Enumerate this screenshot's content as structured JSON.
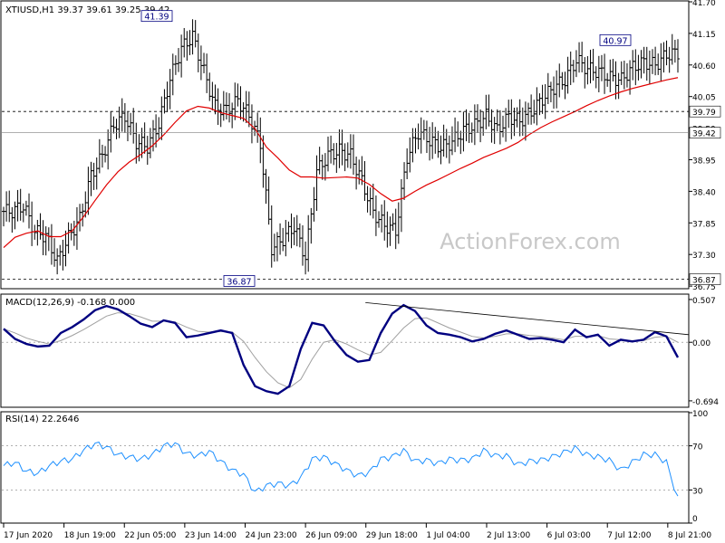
{
  "colors": {
    "background": "#ffffff",
    "frame": "#000000",
    "bar": "#000000",
    "ma": "#e00000",
    "macd_line": "#000080",
    "macd_signal": "#a0a0a0",
    "rsi_line": "#1e90ff",
    "level_line": "#808080",
    "watermark": "#c8c8c8",
    "label_border": "#000080"
  },
  "watermark": "ActionForex.com",
  "chart_data": [
    {
      "type": "ohlc",
      "panel": "price",
      "header": "XTIUSD,H1  39.37 39.61 39.25 39.42",
      "ylim": [
        36.72,
        41.7
      ],
      "yticks": [
        "41.70",
        "41.15",
        "40.60",
        "40.05",
        "39.50",
        "38.95",
        "38.40",
        "37.85",
        "37.30",
        "36.75"
      ],
      "ytick_values": [
        41.7,
        41.15,
        40.6,
        40.05,
        39.5,
        38.95,
        38.4,
        37.85,
        37.3,
        36.75
      ],
      "x": [
        "17 Jun 2020",
        "18 Jun 19:00",
        "22 Jun 05:00",
        "23 Jun 14:00",
        "24 Jun 23:00",
        "26 Jun 09:00",
        "29 Jun 18:00",
        "1 Jul 04:00",
        "2 Jul 13:00",
        "6 Jul 03:00",
        "7 Jul 12:00",
        "8 Jul 21:00"
      ],
      "last_price": 39.42,
      "last_price_label": "39.42",
      "levels": [
        {
          "value": 39.79,
          "label": "39.79",
          "style": "dashed"
        },
        {
          "value": 36.87,
          "label": "36.87",
          "style": "dashed"
        }
      ],
      "annotations": [
        {
          "text": "41.39",
          "value": 41.39
        },
        {
          "text": "36.87",
          "value": 36.87
        },
        {
          "text": "40.97",
          "value": 40.97
        }
      ],
      "series": [
        {
          "kind": "close",
          "values": [
            38.05,
            38.15,
            37.7,
            37.62,
            37.18,
            37.6,
            37.92,
            38.68,
            39.02,
            39.55,
            39.71,
            39.26,
            39.18,
            39.58,
            40.36,
            40.89,
            41.1,
            40.48,
            39.87,
            39.81,
            39.98,
            39.72,
            39.23,
            37.41,
            37.57,
            37.79,
            37.25,
            38.75,
            39.02,
            39.11,
            39.02,
            38.58,
            38.03,
            37.81,
            37.71,
            39.0,
            39.43,
            39.29,
            39.16,
            39.26,
            39.46,
            39.55,
            39.71,
            39.46,
            39.7,
            39.62,
            39.78,
            40.01,
            40.21,
            40.34,
            40.69,
            40.53,
            40.48,
            40.38,
            40.34,
            40.56,
            40.65,
            40.6,
            40.78,
            40.81
          ]
        },
        {
          "kind": "moving_average",
          "values": [
            37.42,
            37.6,
            37.67,
            37.71,
            37.61,
            37.61,
            37.71,
            37.96,
            38.24,
            38.51,
            38.74,
            38.91,
            39.04,
            39.19,
            39.38,
            39.6,
            39.8,
            39.88,
            39.85,
            39.77,
            39.72,
            39.67,
            39.49,
            39.17,
            38.98,
            38.77,
            38.65,
            38.65,
            38.63,
            38.64,
            38.65,
            38.63,
            38.52,
            38.36,
            38.23,
            38.28,
            38.4,
            38.51,
            38.6,
            38.7,
            38.8,
            38.89,
            38.99,
            39.07,
            39.15,
            39.25,
            39.39,
            39.51,
            39.61,
            39.7,
            39.79,
            39.89,
            39.98,
            40.06,
            40.13,
            40.19,
            40.24,
            40.29,
            40.34,
            40.38
          ]
        }
      ]
    },
    {
      "type": "line",
      "panel": "macd",
      "header": "MACD(12,26,9) -0.168 0.000",
      "ylim": [
        -0.77,
        0.56
      ],
      "yticks": [
        "0.507",
        "0.00",
        "-0.694"
      ],
      "ytick_values": [
        0.507,
        0.0,
        -0.694
      ],
      "zero_line": 0.0,
      "series": [
        {
          "kind": "macd",
          "values": [
            0.16,
            0.04,
            -0.02,
            -0.05,
            -0.04,
            0.11,
            0.18,
            0.27,
            0.38,
            0.43,
            0.39,
            0.31,
            0.22,
            0.18,
            0.26,
            0.23,
            0.06,
            0.08,
            0.11,
            0.14,
            0.11,
            -0.27,
            -0.52,
            -0.58,
            -0.61,
            -0.52,
            -0.08,
            0.23,
            0.2,
            0.01,
            -0.15,
            -0.23,
            -0.21,
            0.11,
            0.34,
            0.44,
            0.37,
            0.2,
            0.11,
            0.09,
            0.06,
            0.01,
            0.04,
            0.1,
            0.14,
            0.09,
            0.04,
            0.05,
            0.03,
            0.0,
            0.15,
            0.06,
            0.09,
            -0.04,
            0.03,
            0.01,
            0.03,
            0.12,
            0.07,
            -0.18
          ]
        },
        {
          "kind": "signal",
          "values": [
            0.16,
            0.11,
            0.05,
            0.01,
            -0.02,
            0.02,
            0.08,
            0.15,
            0.23,
            0.31,
            0.35,
            0.34,
            0.3,
            0.25,
            0.25,
            0.24,
            0.18,
            0.13,
            0.12,
            0.13,
            0.12,
            0.01,
            -0.18,
            -0.35,
            -0.48,
            -0.54,
            -0.44,
            -0.2,
            0.0,
            0.03,
            -0.02,
            -0.09,
            -0.15,
            -0.12,
            0.02,
            0.17,
            0.28,
            0.29,
            0.23,
            0.17,
            0.12,
            0.07,
            0.05,
            0.07,
            0.1,
            0.1,
            0.08,
            0.07,
            0.05,
            0.03,
            0.07,
            0.07,
            0.08,
            0.04,
            0.03,
            0.02,
            0.02,
            0.06,
            0.07,
            0.0
          ]
        }
      ],
      "trendline": {
        "from": [
          44,
          0.47
        ],
        "to": [
          83,
          0.09
        ],
        "x_unit": "bar_index_of_83"
      }
    },
    {
      "type": "line",
      "panel": "rsi",
      "header": "RSI(14) 22.2646",
      "ylim": [
        0,
        100
      ],
      "yticks": [
        "100",
        "70",
        "30",
        "0"
      ],
      "ytick_values": [
        100,
        70,
        30,
        0
      ],
      "levels": [
        70,
        30
      ],
      "series": [
        {
          "kind": "rsi",
          "values": [
            52,
            55,
            47,
            45,
            52,
            56,
            58,
            66,
            72,
            69,
            62,
            60,
            58,
            62,
            70,
            72,
            63,
            61,
            65,
            56,
            48,
            44,
            28,
            34,
            36,
            34,
            41,
            58,
            60,
            54,
            48,
            43,
            46,
            58,
            60,
            66,
            56,
            57,
            54,
            58,
            57,
            58,
            66,
            61,
            61,
            53,
            56,
            57,
            60,
            64,
            68,
            62,
            60,
            57,
            48,
            55,
            62,
            62,
            55,
            22
          ]
        }
      ]
    }
  ]
}
